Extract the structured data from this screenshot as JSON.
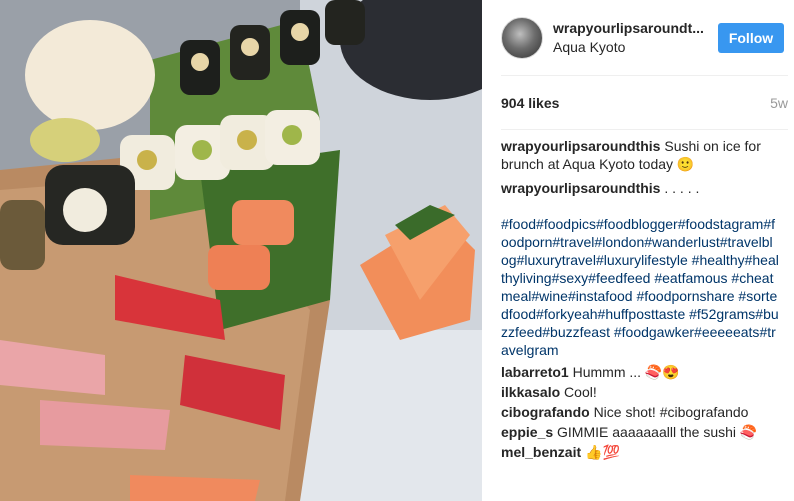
{
  "post": {
    "username": "wrapyourlipsaroundt...",
    "location": "Aqua Kyoto",
    "follow_label": "Follow",
    "likes": "904 likes",
    "time_ago": "5w"
  },
  "caption": {
    "user": "wrapyourlipsaroundthis",
    "text": "Sushi on ice for brunch at Aqua Kyoto today 🙂"
  },
  "second": {
    "user": "wrapyourlipsaroundthis",
    "text": ". . . . ."
  },
  "hashtags": [
    "#food",
    "#foodpics",
    "#foodblogger",
    "#foodstagram",
    "#foodporn",
    "#travel",
    "#london",
    "#wanderlust",
    "#travelblog",
    "#luxurytravel",
    "#luxurylifestyle",
    "#healthy",
    "#healthyliving",
    "#sexy",
    "#feedfeed",
    "#eatfamous",
    "#cheatmeal",
    "#wine",
    "#instafood",
    "#foodpornshare",
    "#sortedfood",
    "#forkyeah",
    "#huffposttaste",
    "#f52grams",
    "#buzzfeed",
    "#buzzfeast",
    "#foodgawker",
    "#eeeeeats",
    "#travelgram"
  ],
  "comments": [
    {
      "user": "labarreto1",
      "text": "Hummm ... 🍣😍"
    },
    {
      "user": "ilkkasalo",
      "text": "Cool!"
    },
    {
      "user": "cibografando",
      "text": "Nice shot! #cibografando"
    },
    {
      "user": "eppie_s",
      "text": "GIMMIE aaaaaaalll the sushi 🍣"
    },
    {
      "user": "mel_benzait",
      "text": "👍💯"
    }
  ],
  "colors": {
    "accent": "#3897f0",
    "hashtag": "#003569",
    "text": "#262626",
    "muted": "#999999"
  }
}
